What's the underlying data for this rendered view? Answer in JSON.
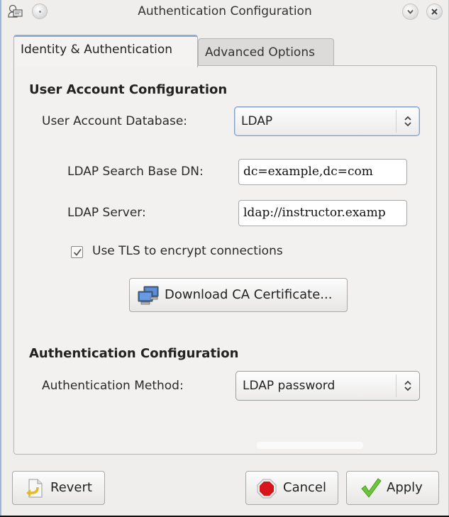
{
  "window": {
    "title": "Authentication Configuration",
    "app_icon": "auth-config-app-icon",
    "controls": {
      "sticky": "sticky-icon",
      "minimize": "chevron-down-icon",
      "close": "close-icon"
    },
    "minimize_glyph": "⌄",
    "close_glyph": "✕"
  },
  "tabs": [
    {
      "label": "Identity & Authentication",
      "active": true
    },
    {
      "label": "Advanced Options",
      "active": false
    }
  ],
  "user_account": {
    "section_title": "User Account Configuration",
    "database_label": "User Account Database:",
    "database_value": "LDAP",
    "search_base_label": "LDAP Search Base DN:",
    "search_base_value": "dc=example,dc=com",
    "server_label": "LDAP Server:",
    "server_value": "ldap://instructor.examp",
    "tls_label": "Use TLS to encrypt connections",
    "tls_checked": true,
    "download_cert_label": "Download CA Certificate..."
  },
  "authentication": {
    "section_title": "Authentication Configuration",
    "method_label": "Authentication Method:",
    "method_value": "LDAP password"
  },
  "footer": {
    "revert_label": "Revert",
    "cancel_label": "Cancel",
    "apply_label": "Apply"
  },
  "colors": {
    "accent": "#8eadd3",
    "cancel_icon": "#d8141b",
    "apply_icon": "#6cc53a",
    "revert_icon": "#e5b824"
  }
}
